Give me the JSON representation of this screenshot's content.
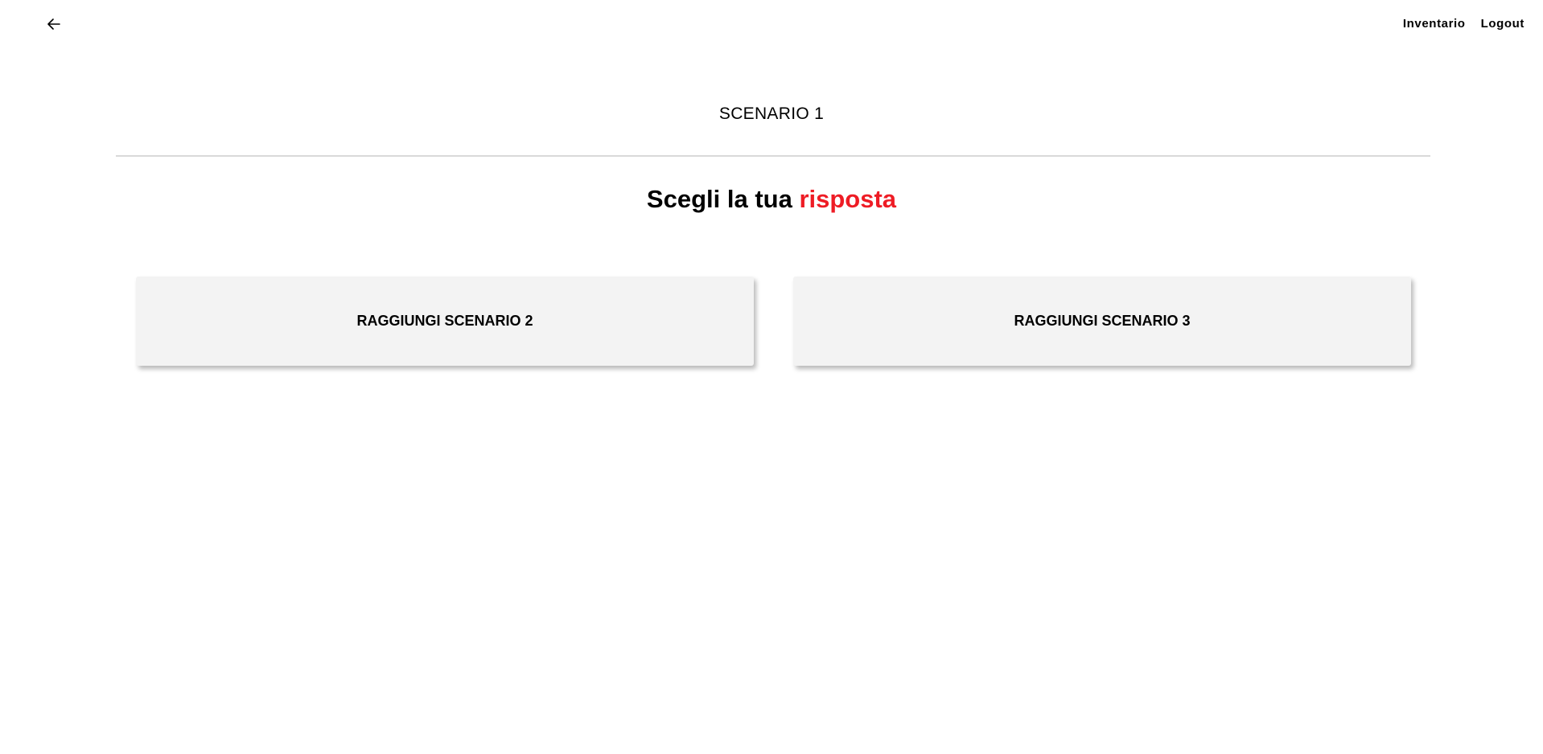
{
  "header": {
    "back_icon": "arrow-left-icon",
    "nav": {
      "inventory_label": "Inventario",
      "logout_label": "Logout"
    }
  },
  "main": {
    "scenario_title": "SCENARIO 1",
    "question_prefix": "Scegli la tua",
    "question_accent": "risposta",
    "choices": [
      {
        "label": "RAGGIUNGI SCENARIO 2"
      },
      {
        "label": "RAGGIUNGI SCENARIO 3"
      }
    ]
  },
  "colors": {
    "accent": "#ee1c25",
    "card_background": "#f3f3f3",
    "divider": "#d9d9d9"
  }
}
